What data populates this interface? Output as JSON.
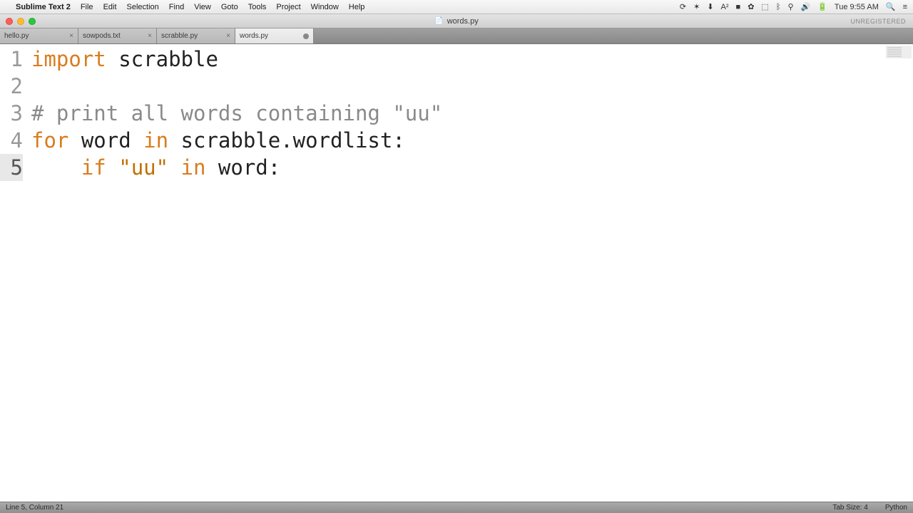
{
  "menubar": {
    "app_name": "Sublime Text 2",
    "items": [
      "File",
      "Edit",
      "Selection",
      "Find",
      "View",
      "Goto",
      "Tools",
      "Project",
      "Window",
      "Help"
    ],
    "clock": "Tue 9:55 AM"
  },
  "titlebar": {
    "filename": "words.py",
    "unregistered": "UNREGISTERED"
  },
  "tabs": [
    {
      "label": "hello.py",
      "active": false,
      "dirty": false
    },
    {
      "label": "sowpods.txt",
      "active": false,
      "dirty": false
    },
    {
      "label": "scrabble.py",
      "active": false,
      "dirty": false
    },
    {
      "label": "words.py",
      "active": true,
      "dirty": true
    }
  ],
  "code": {
    "lines": [
      {
        "n": "1",
        "tokens": [
          {
            "t": "import",
            "c": "kw"
          },
          {
            "t": " scrabble",
            "c": "ident"
          }
        ]
      },
      {
        "n": "2",
        "tokens": []
      },
      {
        "n": "3",
        "tokens": [
          {
            "t": "# print all words containing \"uu\"",
            "c": "cmt"
          }
        ]
      },
      {
        "n": "4",
        "tokens": [
          {
            "t": "for",
            "c": "kw"
          },
          {
            "t": " word ",
            "c": "ident"
          },
          {
            "t": "in",
            "c": "kw"
          },
          {
            "t": " scrabble.wordlist:",
            "c": "ident"
          }
        ]
      },
      {
        "n": "5",
        "tokens": [
          {
            "t": "    ",
            "c": "ident"
          },
          {
            "t": "if",
            "c": "kw"
          },
          {
            "t": " ",
            "c": "ident"
          },
          {
            "t": "\"uu\"",
            "c": "str"
          },
          {
            "t": " ",
            "c": "ident"
          },
          {
            "t": "in",
            "c": "kw"
          },
          {
            "t": " word:",
            "c": "ident"
          }
        ]
      }
    ],
    "current_line": 5
  },
  "statusbar": {
    "position": "Line 5, Column 21",
    "tab_size": "Tab Size: 4",
    "syntax": "Python"
  }
}
